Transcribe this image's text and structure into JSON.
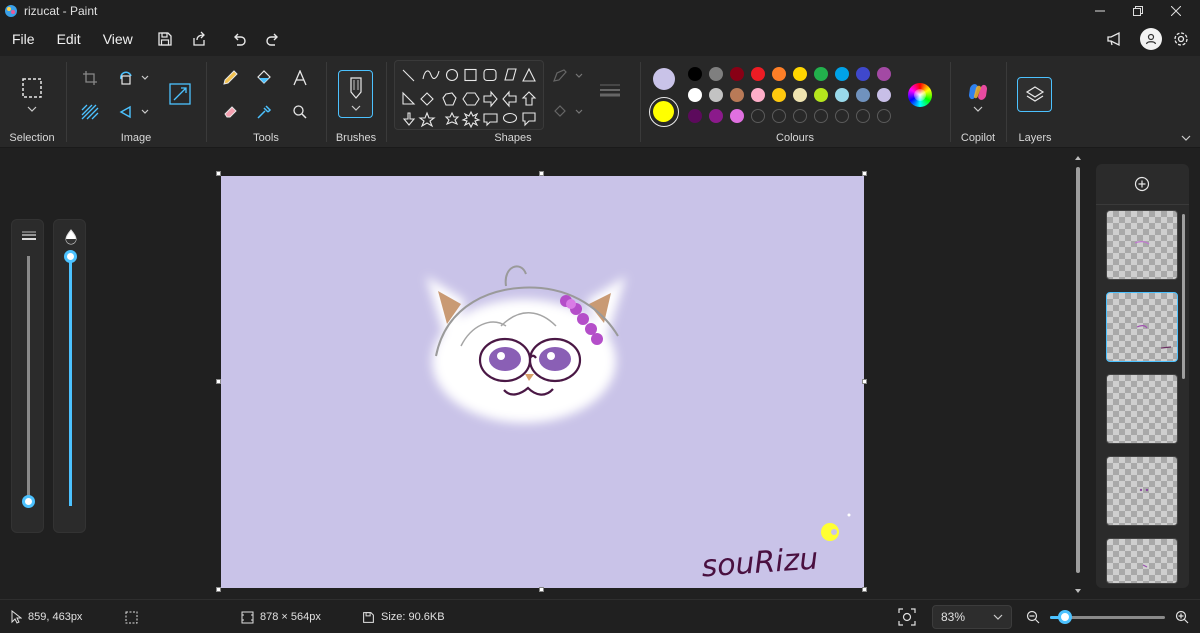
{
  "window": {
    "title": "rizucat - Paint"
  },
  "menu": {
    "file": "File",
    "edit": "Edit",
    "view": "View"
  },
  "ribbon": {
    "selection_label": "Selection",
    "image_label": "Image",
    "tools_label": "Tools",
    "brushes_label": "Brushes",
    "shapes_label": "Shapes",
    "colours_label": "Colours",
    "copilot_label": "Copilot",
    "layers_label": "Layers",
    "colour1": "#c9c3e8",
    "colour2": "#ffff00",
    "palette_row1": [
      "#000000",
      "#7f7f7f",
      "#880015",
      "#ed1c24",
      "#ff7f27",
      "#ffd600",
      "#22b14c",
      "#00a2e8",
      "#3f48cc",
      "#a349a4"
    ],
    "palette_row2": [
      "#ffffff",
      "#c3c3c3",
      "#b97a57",
      "#ffaec9",
      "#ffc90e",
      "#efe4b0",
      "#b5e61d",
      "#99d9ea",
      "#7092be",
      "#c8bfe7"
    ],
    "palette_row3": [
      "#5c0a5c",
      "#8b1a8b",
      "#e070e0",
      "",
      "",
      "",
      "",
      "",
      "",
      ""
    ]
  },
  "canvas": {
    "signature": "souRizu",
    "background": "#c9c3e8"
  },
  "sliders": {
    "size_fraction": 0.02,
    "opacity_fraction": 1.0
  },
  "status": {
    "cursor_position": "859, 463px",
    "canvas_size": "878 × 564px",
    "file_size": "Size: 90.6KB",
    "zoom": "83%",
    "zoom_fraction": 0.13
  }
}
